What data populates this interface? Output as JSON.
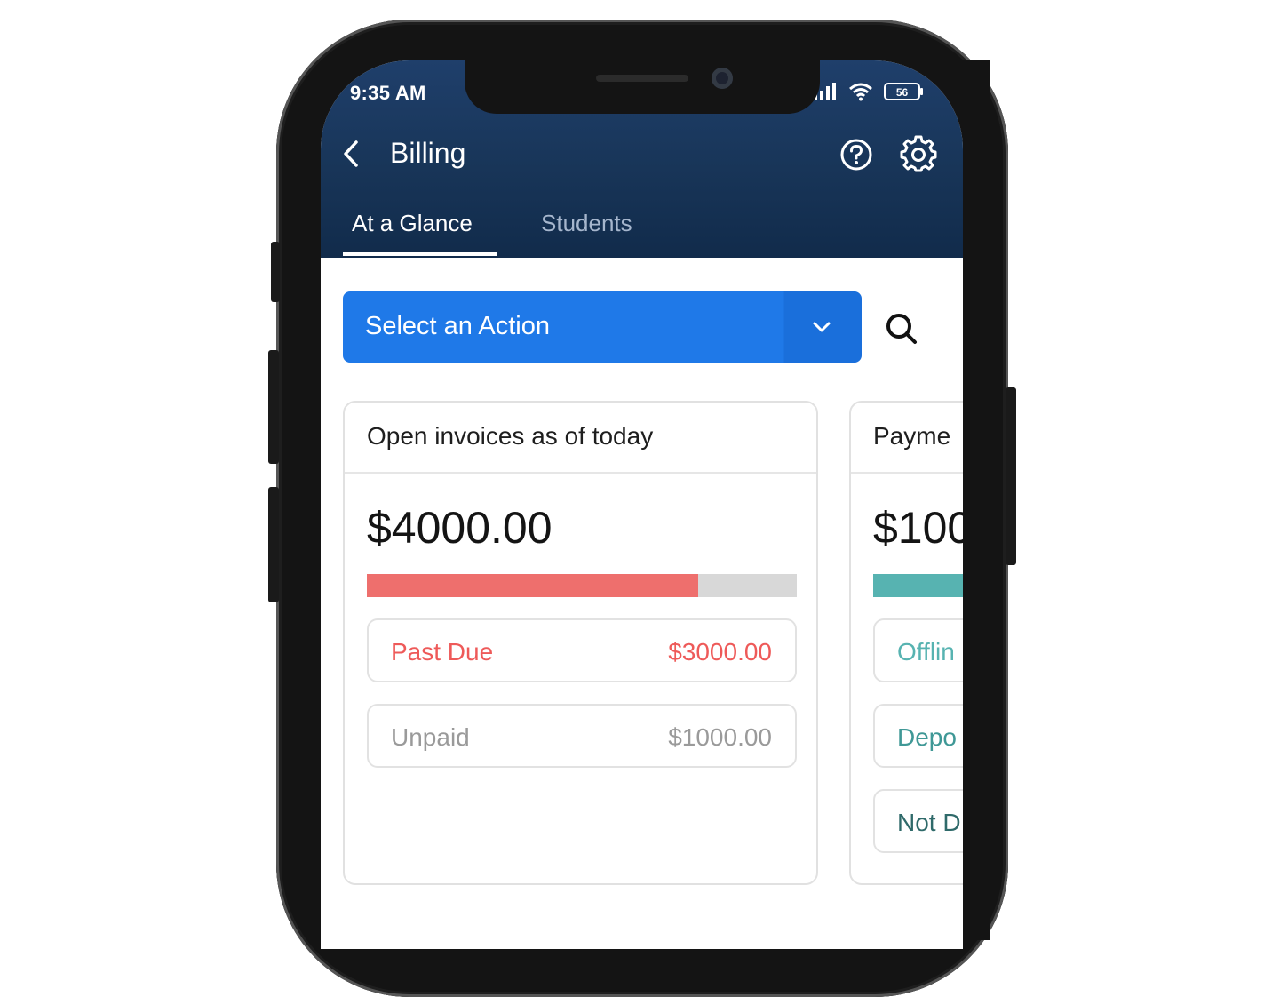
{
  "status_bar": {
    "time": "9:35 AM",
    "battery": "56"
  },
  "header": {
    "title": "Billing"
  },
  "tabs": [
    {
      "label": "At a Glance",
      "active": true
    },
    {
      "label": "Students",
      "active": false
    }
  ],
  "action_select": {
    "label": "Select an Action"
  },
  "colors": {
    "header": "#183558",
    "accent": "#1f79e8",
    "past_due": "#ee6f6d",
    "teal": "#57b3b1",
    "unpaid": "#9a9a9a"
  },
  "cards": [
    {
      "title": "Open invoices as of today",
      "amount": "$4000.00",
      "bar_fraction": 0.77,
      "rows": [
        {
          "label": "Past Due",
          "value": "$3000.00"
        },
        {
          "label": "Unpaid",
          "value": "$1000.00"
        }
      ]
    },
    {
      "title": "Payme",
      "amount": "$100",
      "rows": [
        {
          "label": "Offlin"
        },
        {
          "label": "Depo"
        },
        {
          "label": "Not D"
        }
      ]
    }
  ]
}
